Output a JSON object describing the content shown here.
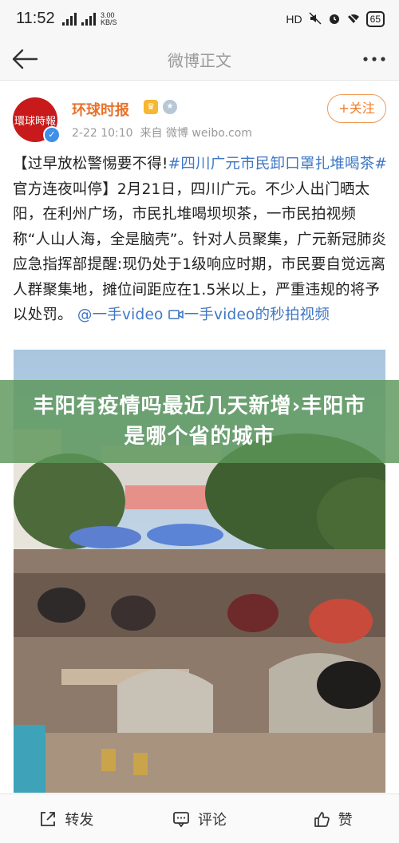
{
  "status_bar": {
    "time": "11:52",
    "network_speed_value": "3.00",
    "network_speed_unit": "KB/S",
    "hd_label": "HD",
    "battery": "65"
  },
  "nav": {
    "title": "微博正文"
  },
  "post": {
    "author": "环球时报",
    "avatar_text": "環球時報",
    "date": "2-22 10:10",
    "source_prefix": "来自",
    "source": "微博 weibo.com",
    "follow_label": "+关注",
    "text_part1": "【过早放松警惕要不得!",
    "hashtag": "#四川广元市民卸口罩扎堆喝茶#",
    "text_part2": " 官方连夜叫停】2月21日，四川广元。不少人出门晒太阳，在利州广场，市民扎堆喝坝坝茶，一市民拍视频称“人山人海，全是脑壳”。针对人员聚集，广元新冠肺炎应急指挥部提醒:现仍处于1级响应时期，市民要自觉远离人群聚集地，摊位间距应在1.5米以上，严重违规的将予以处罚。",
    "mention": "@一手video",
    "video_link_text": "一手video的秒拍视频"
  },
  "overlay": {
    "headline": "丰阳有疫情吗最近几天新增›丰阳市是哪个省的城市"
  },
  "actions": {
    "repost": "转发",
    "comment": "评论",
    "like": "赞"
  },
  "colors": {
    "brand_orange": "#f07c2b",
    "link_blue": "#3f77c4",
    "overlay_green": "#5c9658"
  }
}
